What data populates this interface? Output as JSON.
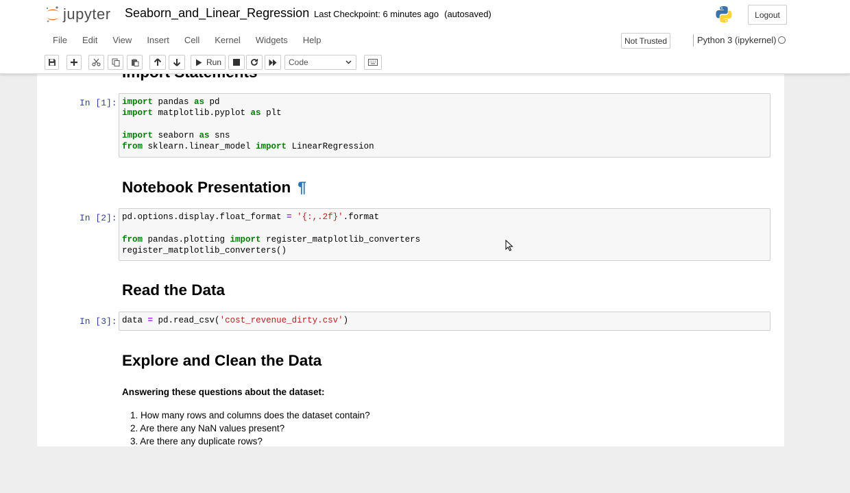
{
  "header": {
    "logo_text": "jupyter",
    "notebook_title": "Seaborn_and_Linear_Regression",
    "checkpoint": "Last Checkpoint: 6 minutes ago",
    "autosave": "(autosaved)",
    "logout_label": "Logout"
  },
  "menu": {
    "items": [
      {
        "label": "File"
      },
      {
        "label": "Edit"
      },
      {
        "label": "View"
      },
      {
        "label": "Insert"
      },
      {
        "label": "Cell"
      },
      {
        "label": "Kernel"
      },
      {
        "label": "Widgets"
      },
      {
        "label": "Help"
      }
    ],
    "trust_label": "Not Trusted",
    "kernel_name": "Python 3 (ipykernel)"
  },
  "toolbar": {
    "run_label": "Run",
    "cell_type": "Code",
    "icons": [
      "save-icon",
      "plus-icon",
      "cut-icon",
      "copy-icon",
      "paste-icon",
      "arrow-up-icon",
      "arrow-down-icon",
      "run-icon",
      "stop-icon",
      "restart-icon",
      "fast-forward-icon",
      "keyboard-icon"
    ]
  },
  "notebook": {
    "partial_heading": "Import Statements",
    "cells": [
      {
        "prompt": "In [1]:",
        "lines": [
          [
            {
              "t": "import",
              "c": "kw"
            },
            {
              "t": " pandas ",
              "c": ""
            },
            {
              "t": "as",
              "c": "kw"
            },
            {
              "t": " pd",
              "c": ""
            }
          ],
          [
            {
              "t": "import",
              "c": "kw"
            },
            {
              "t": " matplotlib.pyplot ",
              "c": ""
            },
            {
              "t": "as",
              "c": "kw"
            },
            {
              "t": " plt",
              "c": ""
            }
          ],
          [],
          [
            {
              "t": "import",
              "c": "kw"
            },
            {
              "t": " seaborn ",
              "c": ""
            },
            {
              "t": "as",
              "c": "kw"
            },
            {
              "t": " sns",
              "c": ""
            }
          ],
          [
            {
              "t": "from",
              "c": "kw"
            },
            {
              "t": " sklearn.linear_model ",
              "c": ""
            },
            {
              "t": "import",
              "c": "kw"
            },
            {
              "t": " LinearRegression",
              "c": ""
            }
          ]
        ]
      },
      {
        "prompt": "In [2]:",
        "lines": [
          [
            {
              "t": "pd.options.display.float_format ",
              "c": ""
            },
            {
              "t": "=",
              "c": "op"
            },
            {
              "t": " ",
              "c": ""
            },
            {
              "t": "'{:,.2f}'",
              "c": "str"
            },
            {
              "t": ".format",
              "c": ""
            }
          ],
          [],
          [
            {
              "t": "from",
              "c": "kw"
            },
            {
              "t": " pandas.plotting ",
              "c": ""
            },
            {
              "t": "import",
              "c": "kw"
            },
            {
              "t": " register_matplotlib_converters",
              "c": ""
            }
          ],
          [
            {
              "t": "register_matplotlib_converters()",
              "c": ""
            }
          ]
        ]
      },
      {
        "prompt": "In [3]:",
        "lines": [
          [
            {
              "t": "data ",
              "c": ""
            },
            {
              "t": "=",
              "c": "op"
            },
            {
              "t": " pd.read_csv(",
              "c": ""
            },
            {
              "t": "'cost_revenue_dirty.csv'",
              "c": "str"
            },
            {
              "t": ")",
              "c": ""
            }
          ]
        ]
      }
    ],
    "headings": {
      "presentation": "Notebook Presentation",
      "pilcrow": "¶",
      "read": "Read the Data",
      "explore": "Explore and Clean the Data"
    },
    "questions_intro": "Answering these questions about the dataset:",
    "questions": [
      "1. How many rows and columns does the dataset contain?",
      "2. Are there any NaN values present?",
      "3. Are there any duplicate rows?"
    ]
  }
}
